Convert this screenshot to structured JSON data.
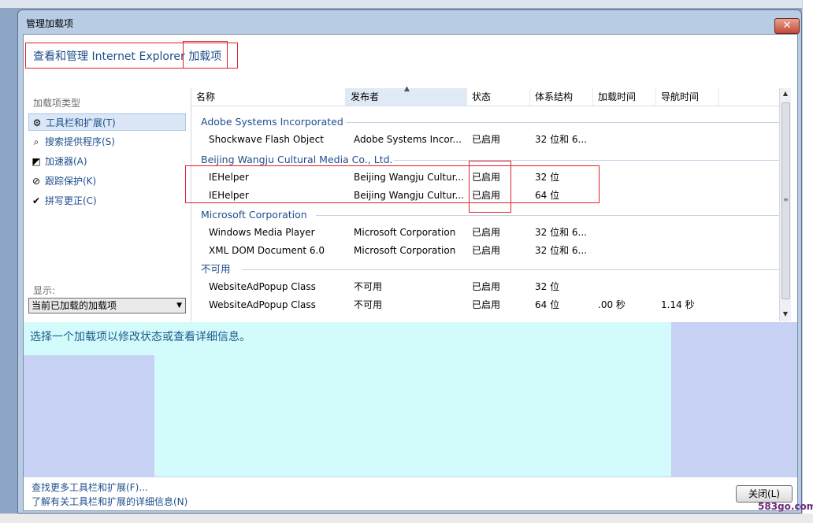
{
  "dialog": {
    "title": "管理加载项",
    "close_glyph": "✕",
    "header": "查看和管理 Internet Explorer 加载项"
  },
  "left": {
    "types_label": "加载项类型",
    "items": [
      {
        "label": "工具栏和扩展(T)",
        "icon": "gear-icon",
        "glyph": "⚙"
      },
      {
        "label": "搜索提供程序(S)",
        "icon": "search-icon",
        "glyph": "⌕"
      },
      {
        "label": "加速器(A)",
        "icon": "accelerator-icon",
        "glyph": "◩"
      },
      {
        "label": "跟踪保护(K)",
        "icon": "no-entry-icon",
        "glyph": "⊘"
      },
      {
        "label": "拼写更正(C)",
        "icon": "spellcheck-icon",
        "glyph": "✔"
      }
    ],
    "show_label": "显示:",
    "show_value": "当前已加载的加载项",
    "show_arrow": "▼"
  },
  "columns": [
    "名称",
    "发布者",
    "状态",
    "体系结构",
    "加载时间",
    "导航时间"
  ],
  "sort_caret": "▲",
  "groups": [
    {
      "name": "Adobe Systems Incorporated",
      "rows": [
        {
          "name": "Shockwave Flash Object",
          "publisher": "Adobe Systems Incor...",
          "status": "已启用",
          "arch": "32 位和 6...",
          "load": "",
          "nav": ""
        }
      ]
    },
    {
      "name": "Beijing Wangju Cultural Media Co., Ltd.",
      "rows": [
        {
          "name": "IEHelper",
          "publisher": "Beijing Wangju Cultur...",
          "status": "已启用",
          "arch": "32 位",
          "load": "",
          "nav": ""
        },
        {
          "name": "IEHelper",
          "publisher": "Beijing Wangju Cultur...",
          "status": "已启用",
          "arch": "64 位",
          "load": "",
          "nav": ""
        }
      ]
    },
    {
      "name": "Microsoft Corporation",
      "rows": [
        {
          "name": "Windows Media Player",
          "publisher": "Microsoft Corporation",
          "status": "已启用",
          "arch": "32 位和 6...",
          "load": "",
          "nav": ""
        },
        {
          "name": "XML DOM Document 6.0",
          "publisher": "Microsoft Corporation",
          "status": "已启用",
          "arch": "32 位和 6...",
          "load": "",
          "nav": ""
        }
      ]
    },
    {
      "name": "不可用",
      "rows": [
        {
          "name": "WebsiteAdPopup Class",
          "publisher": "不可用",
          "status": "已启用",
          "arch": "32 位",
          "load": "",
          "nav": ""
        },
        {
          "name": "WebsiteAdPopup Class",
          "publisher": "不可用",
          "status": "已启用",
          "arch": "64 位",
          "load": ".00 秒",
          "nav": "1.14 秒"
        }
      ]
    }
  ],
  "scroll": {
    "up": "▲",
    "down": "▼",
    "grip": "≡"
  },
  "details_text": "选择一个加载项以修改状态或查看详细信息。",
  "footer": {
    "link1": "查找更多工具栏和扩展(F)...",
    "link2": "了解有关工具栏和扩展的详细信息(N)",
    "close_button": "关闭(L)"
  },
  "watermark": "583go.com",
  "colors": {
    "annotation_red": "#e0202a",
    "link_blue": "#1e4e8c",
    "details_cyan": "#d4fbfb"
  }
}
